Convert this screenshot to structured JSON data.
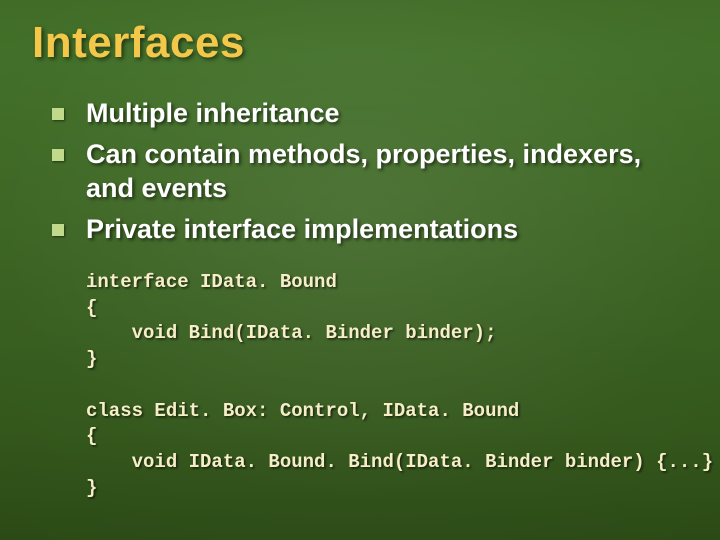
{
  "title": "Interfaces",
  "bullets": [
    "Multiple inheritance",
    "Can contain methods, properties, indexers, and events",
    "Private interface implementations"
  ],
  "chart_data": {
    "type": "table",
    "title": "C# interface example code",
    "code_blocks": [
      "interface IData. Bound\n{\n    void Bind(IData. Binder binder);\n}",
      "class Edit. Box: Control, IData. Bound\n{\n    void IData. Bound. Bind(IData. Binder binder) {...}\n}"
    ]
  },
  "code1": {
    "l1": "interface IData. Bound",
    "l2": "{",
    "l3": "    void Bind(IData. Binder binder);",
    "l4": "}"
  },
  "code2": {
    "l1": "class Edit. Box: Control, IData. Bound",
    "l2": "{",
    "l3": "    void IData. Bound. Bind(IData. Binder binder) {...}",
    "l4": "}"
  }
}
